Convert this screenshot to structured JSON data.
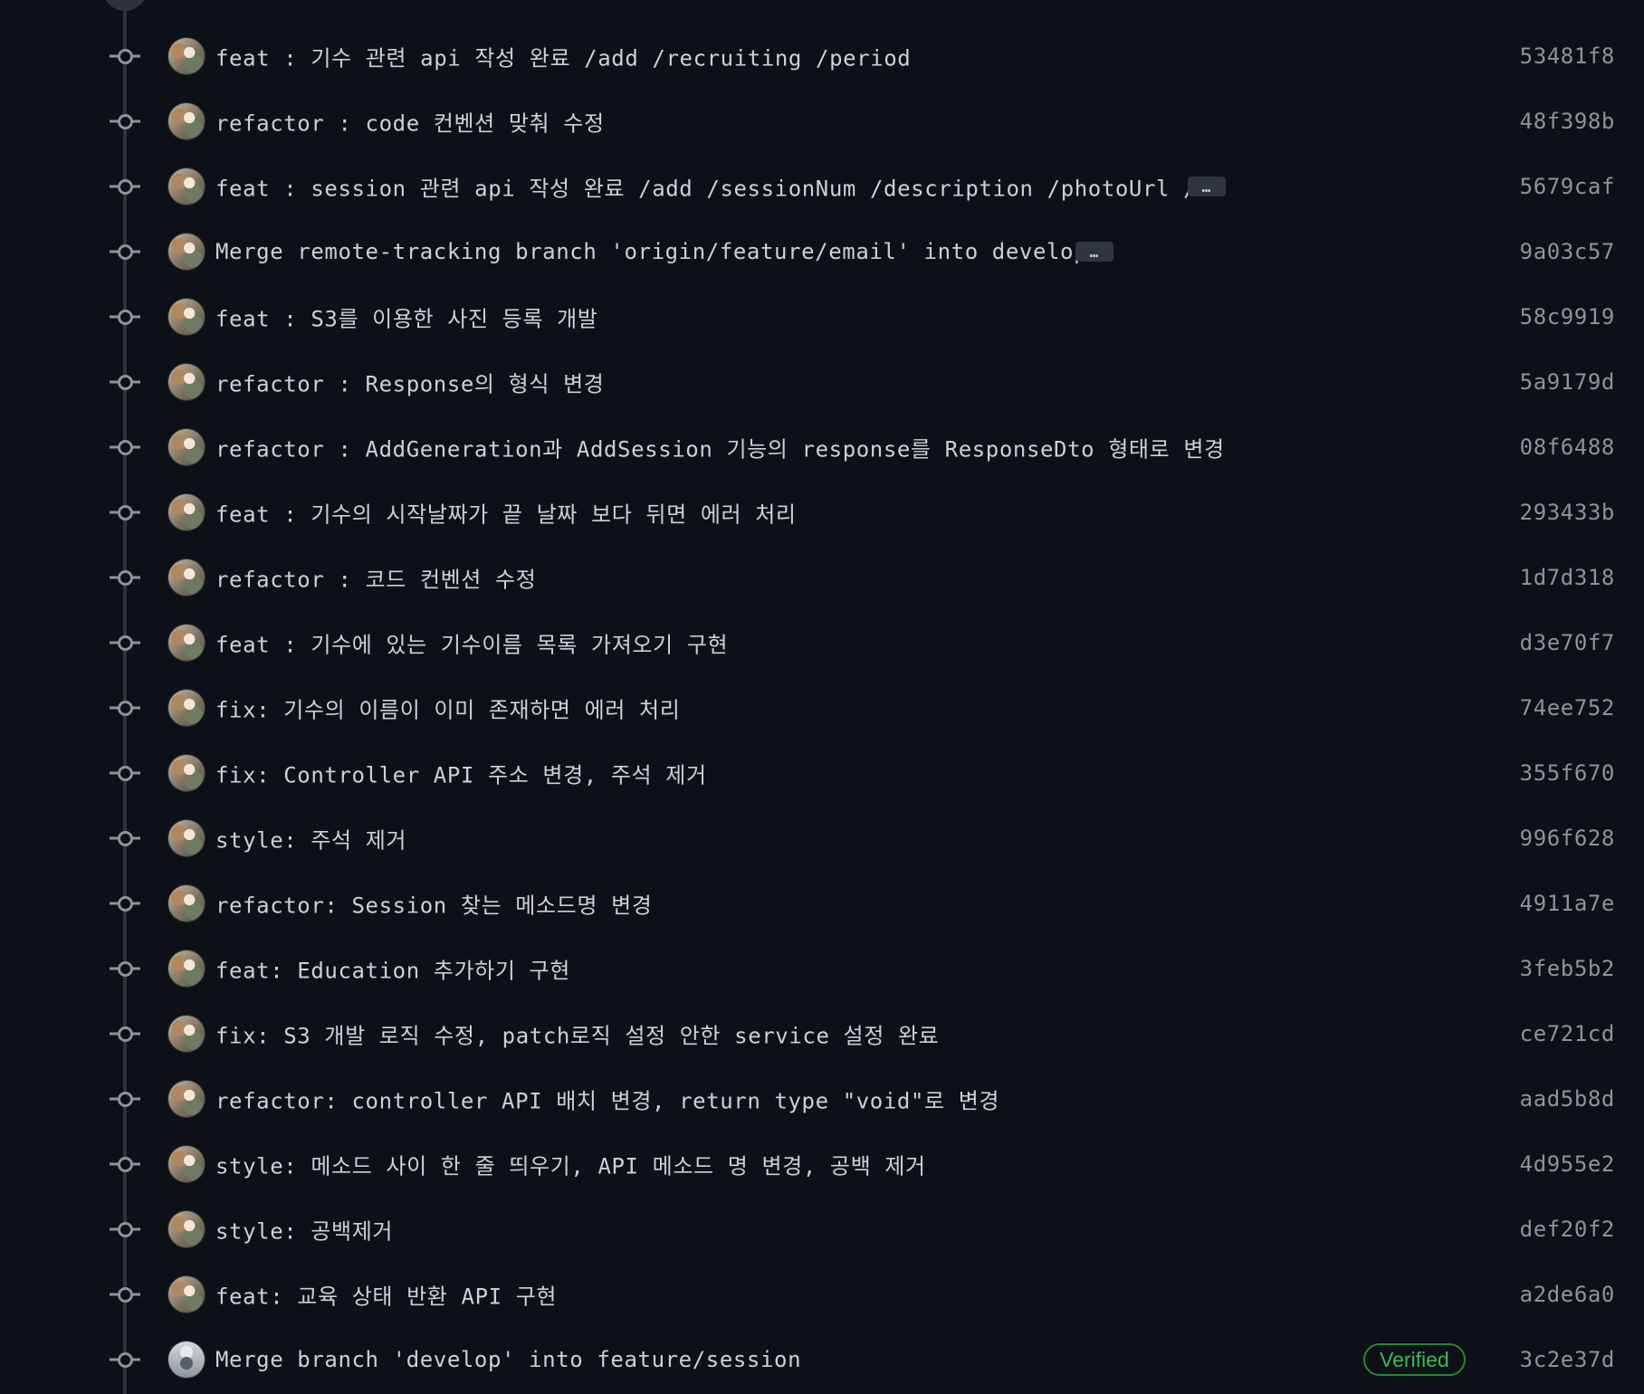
{
  "commits": [
    {
      "message": "feat : 기수 관련 api 작성 완료 /add /recruiting /period",
      "sha": "53481f8"
    },
    {
      "message": "refactor : code 컨벤션 맞춰 수정",
      "sha": "48f398b"
    },
    {
      "message": "feat : session 관련 api 작성 완료 /add /sessionNum /description /photoUrl /…",
      "sha": "5679caf",
      "ellipsis": "…"
    },
    {
      "message": "Merge remote-tracking branch 'origin/feature/email' into develop",
      "sha": "9a03c57",
      "ellipsis": "…"
    },
    {
      "message": "feat : S3를 이용한 사진 등록 개발",
      "sha": "58c9919"
    },
    {
      "message": "refactor : Response의 형식 변경",
      "sha": "5a9179d"
    },
    {
      "message": "refactor : AddGeneration과 AddSession 기능의 response를 ResponseDto 형태로 변경",
      "sha": "08f6488"
    },
    {
      "message": "feat : 기수의 시작날짜가 끝 날짜 보다 뒤면 에러 처리",
      "sha": "293433b"
    },
    {
      "message": "refactor : 코드 컨벤션 수정",
      "sha": "1d7d318"
    },
    {
      "message": "feat : 기수에 있는 기수이름 목록 가져오기 구현",
      "sha": "d3e70f7"
    },
    {
      "message": "fix: 기수의 이름이 이미 존재하면 에러 처리",
      "sha": "74ee752"
    },
    {
      "message": "fix: Controller API 주소 변경, 주석 제거",
      "sha": "355f670"
    },
    {
      "message": "style: 주석 제거",
      "sha": "996f628"
    },
    {
      "message": "refactor: Session 찾는 메소드명 변경",
      "sha": "4911a7e"
    },
    {
      "message": "feat: Education 추가하기 구현",
      "sha": "3feb5b2"
    },
    {
      "message": "fix: S3 개발 로직 수정, patch로직 설정 안한 service 설정 완료",
      "sha": "ce721cd"
    },
    {
      "message": "refactor: controller API 배치 변경, return type \"void\"로 변경",
      "sha": "aad5b8d"
    },
    {
      "message": "style: 메소드 사이 한 줄 띄우기, API 메소드 명 변경, 공백 제거",
      "sha": "4d955e2"
    },
    {
      "message": "style: 공백제거",
      "sha": "def20f2"
    },
    {
      "message": "feat: 교육 상태 반환 API 구현",
      "sha": "a2de6a0"
    },
    {
      "message": "Merge branch 'develop' into feature/session",
      "sha": "3c2e37d",
      "badge": "Verified",
      "avatar": "alt"
    }
  ],
  "colors": {
    "background": "#0d1117",
    "text": "#c9d1d9",
    "muted": "#8b949e",
    "verified": "#3fb950"
  }
}
